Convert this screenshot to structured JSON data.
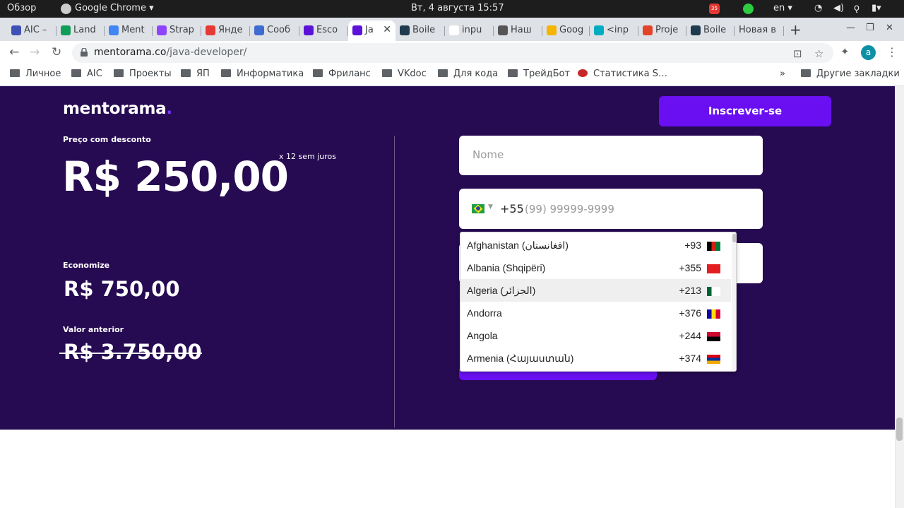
{
  "os": {
    "activities": "Обзор",
    "app_name": "Google Chrome",
    "clock": "Вт, 4 августа  15:57",
    "lang": "en",
    "badge_count": "35"
  },
  "browser": {
    "tabs": [
      {
        "title": "AIC –",
        "color": "#3f51b5"
      },
      {
        "title": "Land",
        "color": "#0f9d58"
      },
      {
        "title": "Ment",
        "color": "#4285f4"
      },
      {
        "title": "Strap",
        "color": "#8e44ff"
      },
      {
        "title": "Янде",
        "color": "#e53935"
      },
      {
        "title": "Сооб",
        "color": "#3d6bd0"
      },
      {
        "title": "Esco",
        "color": "#5b13d8"
      },
      {
        "title": "Ja",
        "color": "#5b13d8"
      },
      {
        "title": "Boile",
        "color": "#1f3b4d"
      },
      {
        "title": "inpu",
        "color": "#ffffff"
      },
      {
        "title": "Наш",
        "color": "#555555"
      },
      {
        "title": "Goog",
        "color": "#f4b400"
      },
      {
        "title": "<inp",
        "color": "#00acc1"
      },
      {
        "title": "Proje",
        "color": "#e24329"
      },
      {
        "title": "Boile",
        "color": "#1f3b4d"
      },
      {
        "title": "Новая в",
        "color": "#dee1e6"
      }
    ],
    "url_host": "mentorama.co",
    "url_path": "/java-developer/",
    "avatar_letter": "a",
    "bookmarks": [
      "Личное",
      "AIC",
      "Проекты",
      "ЯП",
      "Информатика",
      "Фриланс",
      "VKdoc",
      "Для кода",
      "ТрейдБот",
      "Статистика S…"
    ],
    "bookmarks_more": "»",
    "other_bookmarks": "Другие закладки"
  },
  "page": {
    "logo": "mentorama",
    "logo_dot": ".",
    "cta": "Inscrever-se",
    "discount_label": "Preço com desconto",
    "price": "R$ 250,00",
    "installments": "x 12 sem juros",
    "economize_label": "Economize",
    "economize_value": "R$ 750,00",
    "previous_label": "Valor anterior",
    "previous_value": "R$ 3.750,00",
    "name_placeholder": "Nome",
    "phone_code": "+55",
    "phone_placeholder": "(99) 99999-9999",
    "countries": [
      {
        "name": "Afghanistan (‫افغانستان‬‎)",
        "code": "+93",
        "flag": [
          "#000000",
          "#d32011",
          "#007a36"
        ],
        "dir": "v"
      },
      {
        "name": "Albania (Shqipëri)",
        "code": "+355",
        "flag": [
          "#e41e20",
          "#e41e20",
          "#e41e20"
        ],
        "dir": "v"
      },
      {
        "name": "Algeria (‫الجزائر‬‎)",
        "code": "+213",
        "flag": [
          "#006233",
          "#ffffff",
          "#ffffff"
        ],
        "dir": "v"
      },
      {
        "name": "Andorra",
        "code": "+376",
        "flag": [
          "#10069f",
          "#fedd00",
          "#d50032"
        ],
        "dir": "v"
      },
      {
        "name": "Angola",
        "code": "+244",
        "flag": [
          "#cc092f",
          "#000000"
        ],
        "dir": "h"
      },
      {
        "name": "Armenia (Հայաստան)",
        "code": "+374",
        "flag": [
          "#d90012",
          "#0033a0",
          "#f2a800"
        ],
        "dir": "h"
      }
    ],
    "highlighted_country": "Algeria"
  }
}
